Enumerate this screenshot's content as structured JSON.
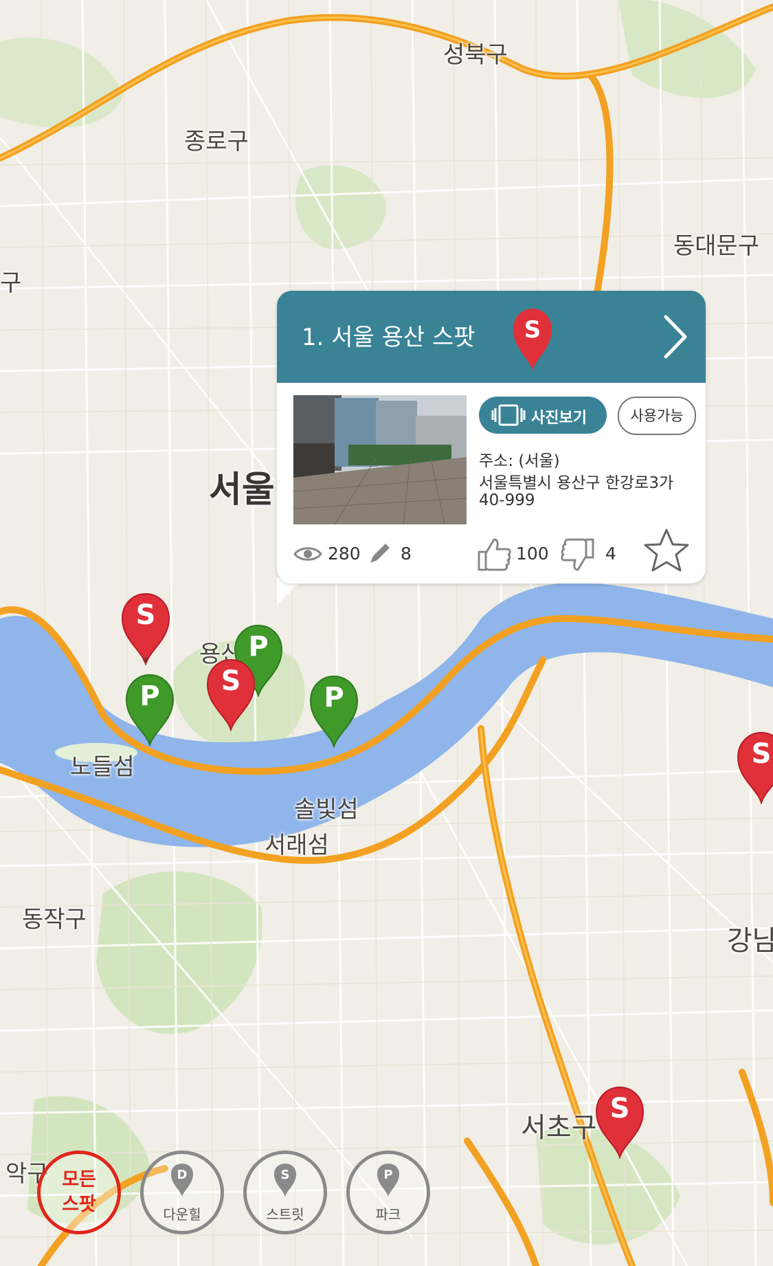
{
  "map": {
    "labels": {
      "seongbuk": "성북구",
      "jongno": "종로구",
      "dongdaemun": "동대문구",
      "gu_left": "구",
      "seoul": "서울",
      "yongsan": "용산",
      "nodeulseom": "노들섬",
      "solbitseom": "솔빛섬",
      "seoraeseom": "서래섬",
      "dongjak": "동작구",
      "gangnam": "강남",
      "seocho": "서초구",
      "gwanak": "악구"
    },
    "marker_glyphs": {
      "street": "S",
      "park": "P"
    }
  },
  "popup": {
    "title": "1. 서울 용산 스팟",
    "pin_letter": "S",
    "photo_button": "사진보기",
    "status_badge": "사용가능",
    "address_label": "주소: (서울)",
    "address_line1": "서울특별시 용산구 한강로3가",
    "address_line2": "40-999",
    "views": "280",
    "comments": "8",
    "likes": "100",
    "dislikes": "4"
  },
  "filters": {
    "all": "모든\n스팟",
    "all_line1": "모든",
    "all_line2": "스팟",
    "downhill_letter": "D",
    "downhill": "다운힐",
    "street_letter": "S",
    "street": "스트릿",
    "park_letter": "P",
    "park": "파크"
  },
  "colors": {
    "accent": "#3a8396",
    "street_marker": "#e0303a",
    "park_marker": "#3f9a2a",
    "river": "#8fb5ea",
    "highway": "#f2a122",
    "all_filter": "#e0261c"
  }
}
